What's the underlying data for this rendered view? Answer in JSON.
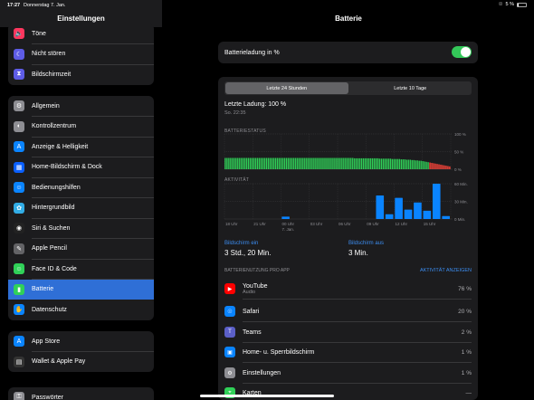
{
  "status": {
    "time": "17:27",
    "date": "Donnerstag 7. Jan.",
    "battery": "5 %"
  },
  "sidebar": {
    "title": "Einstellungen",
    "groups": [
      [
        {
          "label": "Töne",
          "icon": "speaker-icon",
          "color": "#ff375f"
        },
        {
          "label": "Nicht stören",
          "icon": "moon-icon",
          "color": "#5e5ce6"
        },
        {
          "label": "Bildschirmzeit",
          "icon": "hourglass-icon",
          "color": "#5e5ce6"
        }
      ],
      [
        {
          "label": "Allgemein",
          "icon": "gear-icon",
          "color": "#8e8e93"
        },
        {
          "label": "Kontrollzentrum",
          "icon": "switches-icon",
          "color": "#8e8e93"
        },
        {
          "label": "Anzeige & Helligkeit",
          "icon": "text-size-icon",
          "color": "#0a84ff"
        },
        {
          "label": "Home-Bildschirm & Dock",
          "icon": "grid-icon",
          "color": "#0a60ff"
        },
        {
          "label": "Bedienungshilfen",
          "icon": "accessibility-icon",
          "color": "#0a84ff"
        },
        {
          "label": "Hintergrundbild",
          "icon": "flower-icon",
          "color": "#32ade6"
        },
        {
          "label": "Siri & Suchen",
          "icon": "siri-icon",
          "color": "#222"
        },
        {
          "label": "Apple Pencil",
          "icon": "pencil-icon",
          "color": "#636366"
        },
        {
          "label": "Face ID & Code",
          "icon": "faceid-icon",
          "color": "#30d158"
        },
        {
          "label": "Batterie",
          "icon": "battery-icon",
          "color": "#30d158"
        },
        {
          "label": "Datenschutz",
          "icon": "hand-icon",
          "color": "#0a84ff"
        }
      ],
      [
        {
          "label": "App Store",
          "icon": "appstore-icon",
          "color": "#0a84ff"
        },
        {
          "label": "Wallet & Apple Pay",
          "icon": "wallet-icon",
          "color": "#333"
        }
      ],
      [
        {
          "label": "Passwörter",
          "icon": "key-icon",
          "color": "#8e8e93"
        }
      ]
    ]
  },
  "detail": {
    "title": "Batterie",
    "toggle_label": "Batterieladung in %",
    "segments": [
      "Letzte 24 Stunden",
      "Letzte 10 Tage"
    ],
    "last_charge": "Letzte Ladung: 100 %",
    "last_charge_time": "So. 22:35",
    "battery_status_label": "BATTERIESTATUS",
    "activity_label": "AKTIVITÄT",
    "screen_on_label": "Bildschirm ein",
    "screen_on_value": "3 Std., 20 Min.",
    "screen_off_label": "Bildschirm aus",
    "screen_off_value": "3 Min.",
    "usage_header": "BATTERIENUTZUNG PRO APP",
    "usage_link": "AKTIVITÄT ANZEIGEN",
    "apps": [
      {
        "name": "YouTube",
        "sub": "Audio",
        "pct": "76 %",
        "icon": "youtube-icon",
        "color": "#ff0000"
      },
      {
        "name": "Safari",
        "sub": "",
        "pct": "20 %",
        "icon": "compass-icon",
        "color": "#0a84ff"
      },
      {
        "name": "Teams",
        "sub": "",
        "pct": "2 %",
        "icon": "teams-icon",
        "color": "#5b5fc7"
      },
      {
        "name": "Home- u. Sperrbildschirm",
        "sub": "",
        "pct": "1 %",
        "icon": "homescreen-icon",
        "color": "#0a84ff"
      },
      {
        "name": "Einstellungen",
        "sub": "",
        "pct": "1 %",
        "icon": "gear-icon",
        "color": "#8e8e93"
      },
      {
        "name": "Karten",
        "sub": "",
        "pct": "—",
        "icon": "map-icon",
        "color": "#30d158"
      }
    ]
  },
  "chart_data": [
    {
      "type": "bar",
      "title": "BATTERIESTATUS",
      "y_ticks": [
        "100 %",
        "50 %",
        "0 %"
      ],
      "ylim": [
        0,
        100
      ],
      "values": [
        32,
        32,
        32,
        32,
        32,
        32,
        32,
        32,
        32,
        32,
        32,
        32,
        32,
        32,
        32,
        32,
        32,
        32,
        32,
        32,
        32,
        32,
        32,
        32,
        32,
        32,
        32,
        32,
        32,
        32,
        32,
        32,
        32,
        32,
        32,
        32,
        32,
        32,
        32,
        32,
        32,
        32,
        32,
        32,
        32,
        32,
        32,
        32,
        32,
        32,
        32,
        32,
        32,
        32,
        32,
        32,
        32,
        32,
        32,
        32,
        32,
        32,
        32,
        32,
        32,
        32,
        32,
        32,
        32,
        32,
        32,
        32,
        31,
        31,
        31,
        31,
        31,
        31,
        31,
        31,
        31,
        31,
        31,
        31,
        31,
        31,
        30,
        30,
        30,
        30,
        30,
        30,
        30,
        29,
        29,
        29,
        29,
        29,
        28,
        28,
        28,
        27,
        27,
        27,
        26,
        26,
        25,
        25,
        24,
        24,
        23,
        22,
        21,
        20,
        19,
        18,
        17,
        16,
        15,
        14,
        13,
        12,
        11,
        10,
        9,
        8
      ],
      "low_color": "#ff453a",
      "color": "#30d158",
      "grid": true
    },
    {
      "type": "bar",
      "title": "AKTIVITÄT",
      "y_ticks": [
        "60 Min.",
        "30 Min.",
        "0 Min."
      ],
      "ylim": [
        0,
        60
      ],
      "x_ticks": [
        "18 Uhr",
        "21 Uhr",
        "00 Uhr",
        "03 Uhr",
        "06 Uhr",
        "09 Uhr",
        "12 Uhr",
        "15 Uhr"
      ],
      "x_sub": "7. Jan.",
      "values": [
        0,
        0,
        0,
        0,
        0,
        0,
        0,
        0,
        0,
        0,
        0,
        0,
        0,
        0,
        0,
        0,
        0,
        0,
        0,
        2,
        0,
        6,
        0,
        0,
        0,
        0,
        0,
        0,
        0,
        0,
        0,
        0,
        0,
        0,
        0,
        0,
        0,
        0,
        0,
        0,
        0,
        0,
        0,
        0,
        0,
        0,
        0,
        0,
        0,
        0,
        0,
        0,
        0,
        0,
        0,
        0,
        0,
        0,
        0,
        0,
        0,
        0,
        0,
        0,
        0,
        0,
        0,
        0,
        0,
        0,
        0,
        0,
        0,
        0,
        0,
        0,
        0,
        0,
        0,
        0,
        0,
        0,
        0,
        0,
        0,
        0,
        0,
        0,
        0,
        0,
        0,
        0,
        0,
        0,
        0,
        0,
        0,
        0,
        0,
        0,
        0,
        0,
        0,
        0,
        0,
        0,
        0,
        0,
        0,
        0,
        0,
        0,
        0,
        0,
        0,
        0,
        0,
        0,
        0,
        0,
        0,
        0,
        0,
        0,
        0,
        0,
        0,
        0,
        0,
        0,
        0,
        0,
        0,
        0,
        0,
        0,
        0,
        0,
        0,
        0,
        0,
        0,
        0,
        0,
        0,
        0,
        0,
        0,
        0,
        0,
        0,
        0,
        0,
        0,
        0,
        0,
        0,
        0,
        0,
        0,
        0,
        0,
        0,
        0,
        0,
        0,
        0,
        0,
        0,
        0,
        0,
        0,
        0,
        0,
        0,
        0,
        0,
        0,
        0,
        0,
        0,
        0,
        0,
        0,
        0,
        0,
        0,
        0,
        0,
        0,
        0,
        0,
        0,
        0,
        0,
        0,
        0,
        0,
        0,
        0,
        0,
        0,
        0,
        0
      ],
      "hourly": [
        0,
        0,
        2,
        6,
        0,
        0,
        0,
        0,
        0,
        0,
        0,
        0,
        0,
        0,
        0,
        0,
        0,
        0,
        0,
        0,
        0,
        0,
        0,
        0,
        0,
        0,
        0,
        0,
        0,
        0,
        0,
        0,
        0,
        0,
        0,
        0,
        0,
        0,
        0,
        0,
        0,
        0,
        0,
        0,
        0,
        0,
        0,
        0,
        0,
        0,
        0,
        0,
        0,
        0,
        0,
        0,
        0,
        0,
        0,
        0,
        0,
        0,
        0,
        0,
        0,
        0,
        0,
        0,
        0,
        0,
        0,
        0,
        0,
        0,
        0,
        0,
        0,
        0,
        0,
        0,
        0,
        0,
        0,
        0,
        0,
        0,
        0,
        0,
        0,
        0,
        0,
        0,
        0,
        0,
        0,
        0,
        0,
        0,
        0,
        0,
        0,
        0,
        0,
        0,
        0,
        0,
        0,
        0,
        0,
        0,
        0,
        0,
        0,
        0,
        0,
        0,
        0,
        0,
        0,
        0,
        0,
        0,
        0,
        0,
        0,
        0,
        0,
        0,
        0,
        0,
        0,
        0,
        0,
        0,
        0,
        0,
        0,
        0,
        0,
        0,
        0,
        0,
        0,
        0,
        0,
        0,
        0,
        0,
        0,
        0,
        0,
        0,
        0,
        0,
        0,
        0,
        0,
        0,
        0,
        0,
        0,
        0,
        0,
        0,
        0,
        0,
        0,
        0,
        0,
        0,
        0,
        0,
        0,
        0,
        0,
        0,
        0,
        0,
        0,
        0,
        0,
        0,
        0,
        0,
        0,
        0,
        0,
        0,
        0,
        0,
        0,
        0,
        0,
        0,
        0,
        0,
        0,
        0,
        0,
        0,
        0,
        0,
        0
      ],
      "bars": [
        {
          "hour": "00 Uhr",
          "minutes": 4
        },
        {
          "hour": "10 Uhr",
          "minutes": 40
        },
        {
          "hour": "11 Uhr",
          "minutes": 8
        },
        {
          "hour": "12 Uhr",
          "minutes": 36
        },
        {
          "hour": "13 Uhr",
          "minutes": 16
        },
        {
          "hour": "14 Uhr",
          "minutes": 28
        },
        {
          "hour": "15 Uhr",
          "minutes": 14
        },
        {
          "hour": "16 Uhr",
          "minutes": 60
        },
        {
          "hour": "17 Uhr",
          "minutes": 5
        }
      ],
      "color": "#0a84ff",
      "grid": true
    }
  ]
}
